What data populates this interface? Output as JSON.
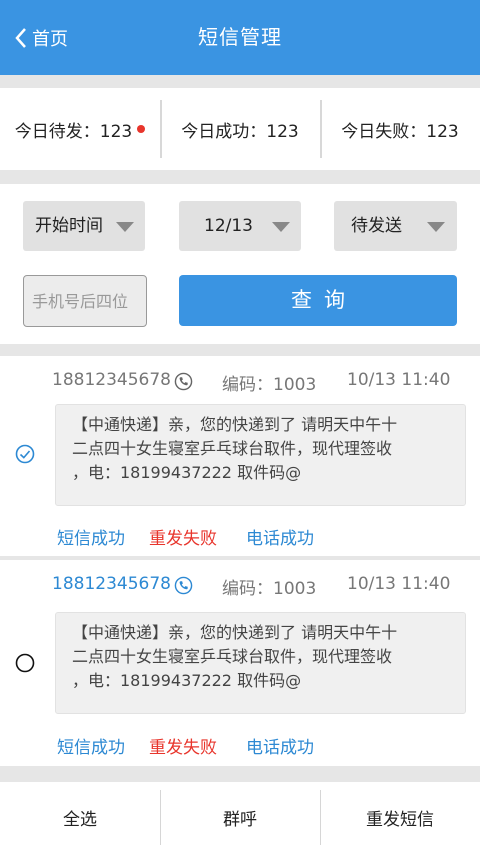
{
  "header": {
    "back_label": "首页",
    "title": "短信管理"
  },
  "stats": [
    {
      "label": "今日待发：123",
      "has_dot": true
    },
    {
      "label": "今日成功：123"
    },
    {
      "label": "今日失败：123"
    }
  ],
  "filters": {
    "start_time_label": "开始时间",
    "date_value": "12/13",
    "status_value": "待发送",
    "phone_placeholder": "手机号后四位",
    "query_label": "查询"
  },
  "messages": [
    {
      "phone": "18812345678",
      "code": "编码：1003",
      "time": "10/13 11:40",
      "line1": "【中通快递】亲，您的快递到了 请明天中午十",
      "line2": "二点四十女生寝室乒乓球台取件，现代理签收",
      "line3": "，电：18199437222  取件码@",
      "selected": true,
      "status_sms": "短信成功",
      "status_resend": "重发失败",
      "status_call": "电话成功"
    },
    {
      "phone": "18812345678",
      "code": "编码：1003",
      "time": "10/13 11:40",
      "line1": "【中通快递】亲，您的快递到了 请明天中午十",
      "line2": "二点四十女生寝室乒乓球台取件，现代理签收",
      "line3": "，电：18199437222  取件码@",
      "selected": false,
      "status_sms": "短信成功",
      "status_resend": "重发失败",
      "status_call": "电话成功"
    }
  ],
  "footer": {
    "select_all": "全选",
    "group_call": "群呼",
    "resend_sms": "重发短信"
  },
  "colors": {
    "primary": "#3a94e2",
    "danger": "#e8352c",
    "link": "#2d89d3"
  }
}
